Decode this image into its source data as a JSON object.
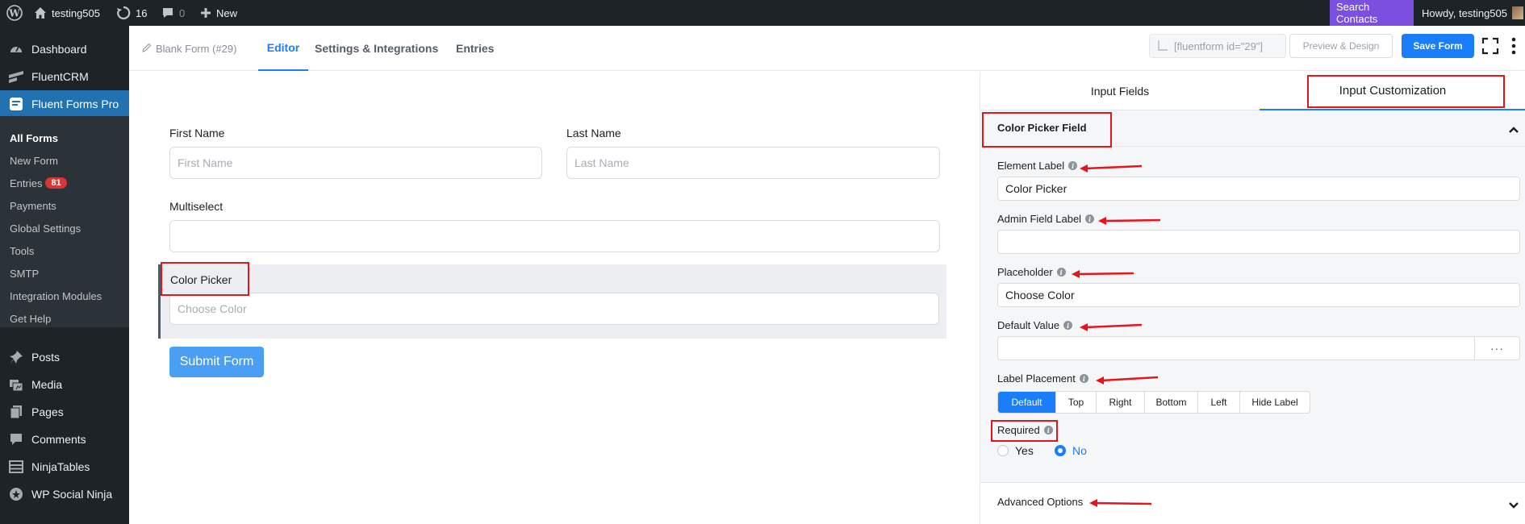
{
  "admin_bar": {
    "site_name": "testing505",
    "updates_count": "16",
    "comments_count": "0",
    "new_label": "New",
    "search_contacts": "Search Contacts",
    "howdy": "Howdy, testing505"
  },
  "sidebar": {
    "items": [
      {
        "label": "Dashboard",
        "icon": "dashboard-icon"
      },
      {
        "label": "FluentCRM",
        "icon": "fluentcrm-icon"
      },
      {
        "label": "Fluent Forms Pro",
        "icon": "fluent-forms-icon"
      },
      {
        "label": "Posts",
        "icon": "pin-icon"
      },
      {
        "label": "Media",
        "icon": "media-icon"
      },
      {
        "label": "Pages",
        "icon": "pages-icon"
      },
      {
        "label": "Comments",
        "icon": "comments-icon"
      },
      {
        "label": "NinjaTables",
        "icon": "table-icon"
      },
      {
        "label": "WP Social Ninja",
        "icon": "social-ninja-icon"
      }
    ],
    "submenu": [
      {
        "label": "All Forms"
      },
      {
        "label": "New Form"
      },
      {
        "label": "Entries",
        "badge": "81"
      },
      {
        "label": "Payments"
      },
      {
        "label": "Global Settings"
      },
      {
        "label": "Tools"
      },
      {
        "label": "SMTP"
      },
      {
        "label": "Integration Modules"
      },
      {
        "label": "Get Help"
      }
    ]
  },
  "header": {
    "form_name": "Blank Form (#29)",
    "tabs": [
      {
        "label": "Editor"
      },
      {
        "label": "Settings & Integrations"
      },
      {
        "label": "Entries"
      }
    ],
    "shortcode": "[fluentform id=\"29\"]",
    "preview_label": "Preview & Design",
    "save_label": "Save Form"
  },
  "form": {
    "first_name_label": "First Name",
    "first_name_placeholder": "First Name",
    "last_name_label": "Last Name",
    "last_name_placeholder": "Last Name",
    "multiselect_label": "Multiselect",
    "color_picker_label": "Color Picker",
    "color_picker_placeholder": "Choose Color",
    "submit_label": "Submit Form"
  },
  "panel": {
    "tabs": [
      {
        "label": "Input Fields"
      },
      {
        "label": "Input Customization"
      }
    ],
    "section_title": "Color Picker Field",
    "element_label": "Element Label",
    "element_label_value": "Color Picker",
    "admin_field_label": "Admin Field Label",
    "admin_field_value": "",
    "placeholder_label": "Placeholder",
    "placeholder_value": "Choose Color",
    "default_value_label": "Default Value",
    "default_value": "",
    "default_value_more": "···",
    "label_placement_label": "Label Placement",
    "placement_options": [
      "Default",
      "Top",
      "Right",
      "Bottom",
      "Left",
      "Hide Label"
    ],
    "placement_selected": "Default",
    "required_label": "Required",
    "required_yes": "Yes",
    "required_no": "No",
    "required_selected": "No",
    "advanced_options": "Advanced Options"
  },
  "colors": {
    "primary": "#1a7efb",
    "annotation": "#e8141c",
    "admin_bar": "#1d2327",
    "search_contacts_bg": "#7b4fe0"
  }
}
